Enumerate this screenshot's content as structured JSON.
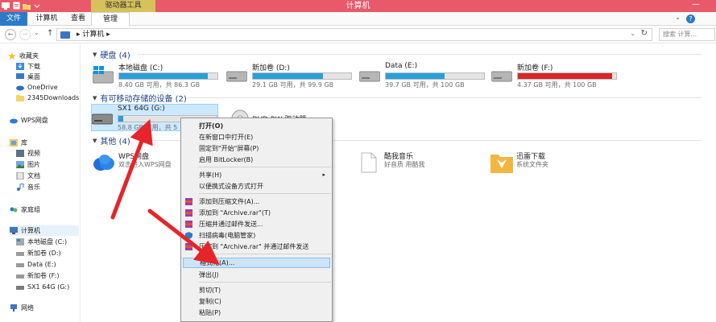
{
  "window": {
    "title": "计算机",
    "context_tab_header": "驱动器工具",
    "minimize_glyph": "—"
  },
  "ribbon": {
    "tabs": [
      "文件",
      "计算机",
      "查看",
      "管理"
    ],
    "help": "?"
  },
  "navbar": {
    "back": "←",
    "forward": "→",
    "dropdown": "⌄",
    "up": "↑",
    "path": "▸ 计算机 ▸",
    "address_dropdown": "⌄",
    "refresh": "↻",
    "search_placeholder": "搜索 计算..."
  },
  "sidebar": {
    "favorites": "收藏夹",
    "downloads": "下载",
    "desktop": "桌面",
    "onedrive": "OneDrive",
    "downloads2345": "2345Downloads",
    "wps": "WPS网盘",
    "libraries": "库",
    "videos": "视频",
    "pictures": "图片",
    "documents": "文档",
    "music": "音乐",
    "homegroup": "家庭组",
    "computer": "计算机",
    "drive_c": "本地磁盘 (C:)",
    "drive_d": "新加卷 (D:)",
    "drive_e": "Data (E:)",
    "drive_f": "新加卷 (F:)",
    "drive_g": "SX1 64G (G:)",
    "network": "网络"
  },
  "content": {
    "sections": {
      "hdd": "硬盘 (4)",
      "removable": "有可移动存储的设备 (2)",
      "other": "其他 (4)"
    },
    "drives": [
      {
        "name": "本地磁盘 (C:)",
        "info": "8.40 GB 可用，共 86.3 GB",
        "used": 0.9
      },
      {
        "name": "新加卷 (D:)",
        "info": "29.1 GB 可用，共 99.9 GB",
        "used": 0.71
      },
      {
        "name": "Data (E:)",
        "info": "39.7 GB 可用，共 100 GB",
        "used": 0.6
      },
      {
        "name": "新加卷 (F:)",
        "info": "4.37 GB 可用，共 100 GB",
        "used": 0.96
      }
    ],
    "removable": {
      "usb_name": "SX1 64G (G:)",
      "usb_info": "58.8 GB 可用，共 5",
      "usb_used": 0.05,
      "dvd_name": "DVD RW 驱动器"
    },
    "other": [
      {
        "name": "WPS网盘",
        "sub": "双击进入WPS网盘"
      },
      {
        "name": "酷我音乐",
        "sub": "好音质 用酷我"
      },
      {
        "name": "迅雷下载",
        "sub": "系统文件夹"
      }
    ]
  },
  "context_menu": {
    "open": "打开(O)",
    "open_new_window": "在新窗口中打开(E)",
    "pin_start": "固定到\"开始\"屏幕(P)",
    "bitlocker": "启用 BitLocker(B)",
    "share": "共享(H)",
    "open_portable": "以便携式设备方式打开",
    "add_archive": "添加到压缩文件(A)...",
    "add_rar": "添加到 \"Archive.rar\"(T)",
    "compress_email": "压缩并通过邮件发送...",
    "scan_virus": "扫描病毒(电脑管家)",
    "compress_rar_email": "压缩到 \"Archive.rar\" 并通过邮件发送",
    "format": "格式化(A)...",
    "eject": "弹出(J)",
    "cut": "剪切(T)",
    "copy": "复制(C)",
    "paste": "粘贴(P)",
    "submenu_arrow": "▸"
  },
  "colors": {
    "titlebar": "#e8596a",
    "file_tab": "#2b7bc9",
    "bar_normal": "#26a0da",
    "bar_low": "#da2626",
    "annotation_arrow": "#e5252a"
  }
}
